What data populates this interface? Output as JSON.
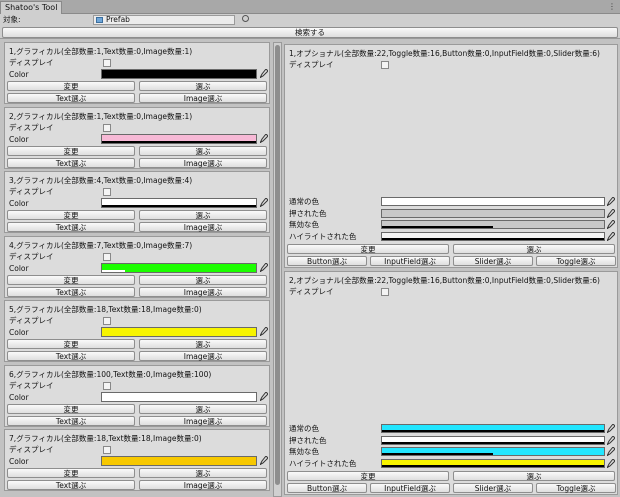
{
  "window": {
    "tab_title": "Shatoo's Tool",
    "menu_icon": "ellipsis-menu-icon"
  },
  "target": {
    "label": "対象:",
    "value": "Prefab",
    "icon": "prefab-cube-icon"
  },
  "search_button": "検索する",
  "graphics_panels": [
    {
      "title": "1,グラフィカル(全部数量:1,Text数量:0,Image数量:1)",
      "display_label": "ディスプレイ",
      "color_label": "Color",
      "color": "#000000",
      "bar": 0.0,
      "bar_color": "#ffffff",
      "buttons": [
        "変更",
        "選ぶ",
        "Text選ぶ",
        "Image選ぶ"
      ]
    },
    {
      "title": "2,グラフィカル(全部数量:1,Text数量:0,Image数量:1)",
      "display_label": "ディスプレイ",
      "color_label": "Color",
      "color": "#f7b9d6",
      "bar": 1.0,
      "bar_color": "#000000",
      "buttons": [
        "変更",
        "選ぶ",
        "Text選ぶ",
        "Image選ぶ"
      ]
    },
    {
      "title": "3,グラフィカル(全部数量:4,Text数量:0,Image数量:4)",
      "display_label": "ディスプレイ",
      "color_label": "Color",
      "color": "#ffffff",
      "bar": 1.0,
      "bar_color": "#000000",
      "buttons": [
        "変更",
        "選ぶ",
        "Text選ぶ",
        "Image選ぶ"
      ]
    },
    {
      "title": "4,グラフィカル(全部数量:7,Text数量:0,Image数量:7)",
      "display_label": "ディスプレイ",
      "color_label": "Color",
      "color": "#1cff00",
      "bar": 0.15,
      "bar_color": "#ffffff",
      "buttons": [
        "変更",
        "選ぶ",
        "Text選ぶ",
        "Image選ぶ"
      ]
    },
    {
      "title": "5,グラフィカル(全部数量:18,Text数量:18,Image数量:0)",
      "display_label": "ディスプレイ",
      "color_label": "Color",
      "color": "#f7f400",
      "bar": 0.0,
      "bar_color": "#000000",
      "buttons": [
        "変更",
        "選ぶ",
        "Text選ぶ",
        "Image選ぶ"
      ]
    },
    {
      "title": "6,グラフィカル(全部数量:100,Text数量:0,Image数量:100)",
      "display_label": "ディスプレイ",
      "color_label": "Color",
      "color": "#ffffff",
      "bar": 0.0,
      "bar_color": "#000000",
      "buttons": [
        "変更",
        "選ぶ",
        "Text選ぶ",
        "Image選ぶ"
      ]
    },
    {
      "title": "7,グラフィカル(全部数量:18,Text数量:18,Image数量:0)",
      "display_label": "ディスプレイ",
      "color_label": "Color",
      "color": "#f7c800",
      "bar": 0.0,
      "bar_color": "#000000",
      "buttons": [
        "変更",
        "選ぶ",
        "Text選ぶ",
        "Image選ぶ"
      ]
    }
  ],
  "optional_panels": [
    {
      "title": "1,オプショナル(全部数量:22,Toggle数量:16,Button数量:0,InputField数量:0,Slider数量:6)",
      "display_label": "ディスプレイ",
      "colors": [
        {
          "label": "通常の色",
          "color": "#ffffff",
          "bar": 1.0,
          "bar_color": "#ffffff"
        },
        {
          "label": "押された色",
          "color": "#c8c8c8",
          "bar": 1.0,
          "bar_color": "#c8c8c8"
        },
        {
          "label": "無効な色",
          "color": "#c8c8c8",
          "bar": 0.5,
          "bar_color": "#000000"
        },
        {
          "label": "ハイライトされた色",
          "color": "#f5f5f5",
          "bar": 1.0,
          "bar_color": "#000000"
        }
      ],
      "buttons": [
        "変更",
        "選ぶ"
      ],
      "type_buttons": [
        "Button選ぶ",
        "InputField選ぶ",
        "Slider選ぶ",
        "Toggle選ぶ"
      ]
    },
    {
      "title": "2,オプショナル(全部数量:22,Toggle数量:16,Button数量:0,InputField数量:0,Slider数量:6)",
      "display_label": "ディスプレイ",
      "colors": [
        {
          "label": "通常の色",
          "color": "#22e6ff",
          "bar": 1.0,
          "bar_color": "#000000"
        },
        {
          "label": "押された色",
          "color": "#ffffff",
          "bar": 1.0,
          "bar_color": "#000000"
        },
        {
          "label": "無効な色",
          "color": "#22e6ff",
          "bar": 0.5,
          "bar_color": "#000000"
        },
        {
          "label": "ハイライトされた色",
          "color": "#f7f400",
          "bar": 1.0,
          "bar_color": "#000000"
        }
      ],
      "buttons": [
        "変更",
        "選ぶ"
      ],
      "type_buttons": [
        "Button選ぶ",
        "InputField選ぶ",
        "Slider選ぶ",
        "Toggle選ぶ"
      ]
    }
  ]
}
